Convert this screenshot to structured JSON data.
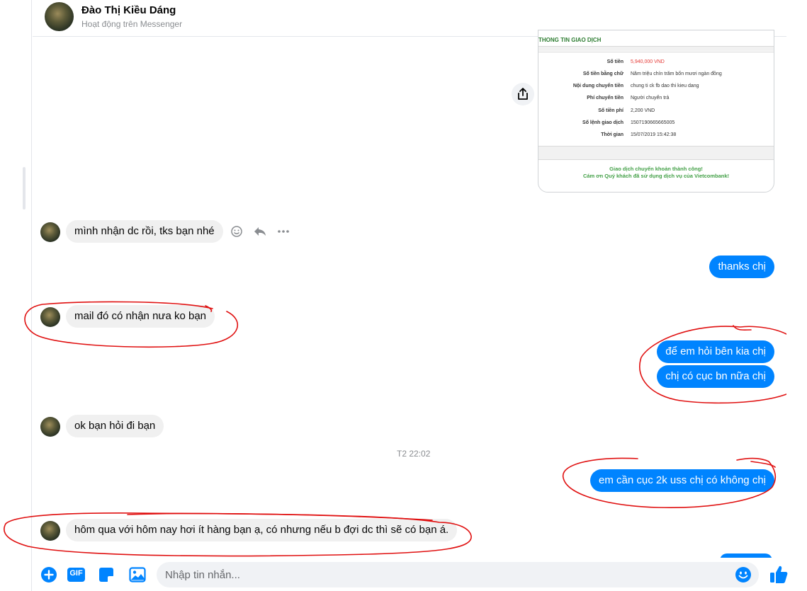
{
  "header": {
    "name": "Đào Thị Kiều Dáng",
    "status": "Hoạt động trên Messenger"
  },
  "receipt": {
    "title": "THONG TIN GIAO DỊCH",
    "rows": [
      {
        "label": "Số tiền",
        "value": "5,940,000 VND"
      },
      {
        "label": "Số tiền bằng chữ",
        "value": "Năm triệu chín trăm bốn mươi ngàn đồng"
      },
      {
        "label": "Nội dung chuyển tiền",
        "value": "chung ti ck fb dao thi kieu dang"
      },
      {
        "label": "Phí chuyển tiền",
        "value": "Người chuyển trả"
      },
      {
        "label": "Số tiền phí",
        "value": "2,200 VND"
      },
      {
        "label": "Số lệnh giao dịch",
        "value": "1507190665665005"
      },
      {
        "label": "Thời gian",
        "value": "15/07/2019 15:42:38"
      }
    ],
    "footer_line1": "Giao dịch chuyển khoản thành công!",
    "footer_line2": "Cám ơn Quý khách đã sử dụng dịch vụ của Vietcombank!"
  },
  "messages": {
    "m1": "mình nhận dc rồi, tks bạn nhé",
    "m2": "thanks chị",
    "m3": "mail đó có nhận nưa ko bạn",
    "m4": "để em hỏi bên kia chị",
    "m5": "chị có cục bn nữa chị",
    "m6": "ok bạn hỏi đi bạn",
    "timestamp": "T2 22:02",
    "m7": "em cần cục 2k uss chị có không chị",
    "m8": "hôm qua với hôm nay hơi ít hàng bạn ạ, có nhưng nếu b đợi dc thì sẽ có bạn á."
  },
  "composer": {
    "gif_label": "GIF",
    "placeholder": "Nhập tin nhắn..."
  },
  "colors": {
    "accent": "#0084ff",
    "annotation": "#e01010",
    "incoming_bubble": "#f0f0f0"
  },
  "icons": [
    "share-icon",
    "emoji-reaction-icon",
    "reply-icon",
    "more-icon",
    "plus-icon",
    "gif-icon",
    "sticker-icon",
    "image-icon",
    "emoji-icon",
    "like-icon"
  ]
}
